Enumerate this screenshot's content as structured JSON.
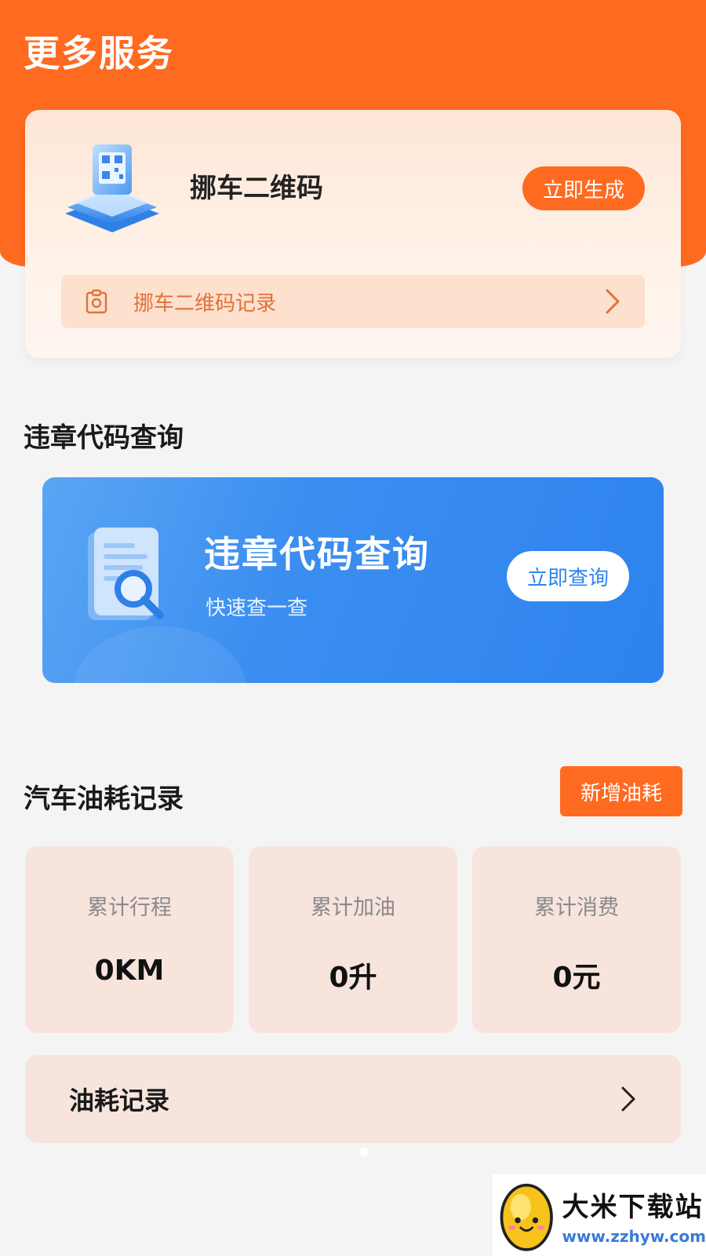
{
  "header": {
    "title": "更多服务"
  },
  "qr_card": {
    "title": "挪车二维码",
    "generate_label": "立即生成",
    "record_label": "挪车二维码记录"
  },
  "violation": {
    "section_title": "违章代码查询",
    "banner_title": "违章代码查询",
    "banner_subtitle": "快速查一查",
    "query_label": "立即查询"
  },
  "fuel": {
    "section_title": "汽车油耗记录",
    "add_label": "新增油耗",
    "stats": [
      {
        "label": "累计行程",
        "value": "0KM"
      },
      {
        "label": "累计加油",
        "value": "0升"
      },
      {
        "label": "累计消费",
        "value": "0元"
      }
    ],
    "record_label": "油耗记录"
  },
  "watermark": {
    "name": "大米下载站",
    "url": "www.zzhyw.com"
  },
  "colors": {
    "primary_orange": "#ff6a21",
    "banner_blue": "#3b8ef0",
    "card_peach": "#f7e4dc"
  }
}
